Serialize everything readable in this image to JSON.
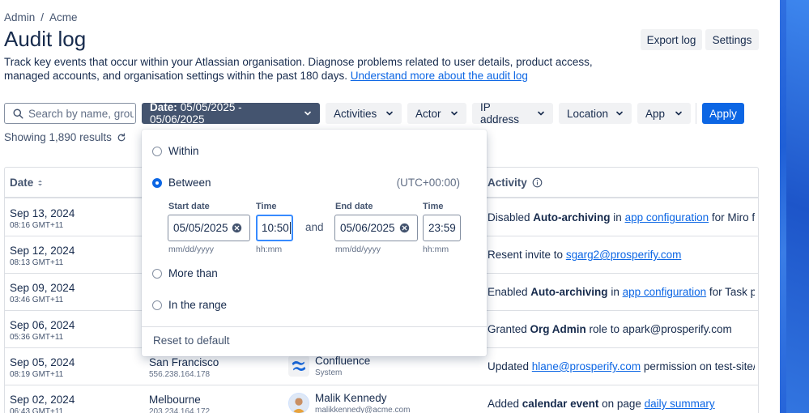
{
  "breadcrumb": {
    "items": [
      "Admin",
      "Acme"
    ],
    "separator": "/"
  },
  "page": {
    "title": "Audit log",
    "description": "Track key events that occur within your Atlassian organisation. Diagnose problems related to user details, product access, managed accounts, and organisation settings within the past 180 days.",
    "learn_link": "Understand more about the audit log"
  },
  "header_actions": {
    "export": "Export log",
    "settings": "Settings"
  },
  "search": {
    "placeholder": "Search by name, group"
  },
  "filters": {
    "date_label": "Date:",
    "date_value": "05/05/2025 - 05/06/2025",
    "activities": "Activities",
    "actor": "Actor",
    "ip": "IP address",
    "location": "Location",
    "app": "App",
    "apply": "Apply"
  },
  "results": {
    "text": "Showing 1,890 results"
  },
  "table": {
    "headers": {
      "date": "Date",
      "activity": "Activity"
    },
    "rows": [
      {
        "date": "Sep 13, 2024",
        "time": "08:16 GMT+11",
        "location": "",
        "ip": "",
        "actor": "",
        "actor_sub": "",
        "activity": [
          {
            "t": "Disabled "
          },
          {
            "b": "Auto-archiving"
          },
          {
            "t": " in "
          },
          {
            "a": "app configuration"
          },
          {
            "t": " for Miro for Con"
          }
        ]
      },
      {
        "date": "Sep 12, 2024",
        "time": "08:13 GMT+11",
        "location": "",
        "ip": "",
        "actor": "",
        "actor_sub": "",
        "activity": [
          {
            "t": "Resent invite to "
          },
          {
            "a": "sgarg2@prosperify.com"
          }
        ]
      },
      {
        "date": "Sep 09, 2024",
        "time": "03:46 GMT+11",
        "location": "",
        "ip": "",
        "actor": "",
        "actor_sub": "",
        "activity": [
          {
            "t": "Enabled "
          },
          {
            "b": "Auto-archiving"
          },
          {
            "t": " in "
          },
          {
            "a": "app configuration"
          },
          {
            "t": " for Task planner"
          }
        ]
      },
      {
        "date": "Sep 06, 2024",
        "time": "05:36 GMT+11",
        "location": "",
        "ip": "",
        "actor": "",
        "actor_sub": "",
        "activity": [
          {
            "t": "Granted "
          },
          {
            "b": "Org Admin"
          },
          {
            "t": " role to apark@prosperify.com"
          }
        ]
      },
      {
        "date": "Sep 05, 2024",
        "time": "08:19 GMT+11",
        "location": "San Francisco",
        "ip": "556.238.164.178",
        "actor": "Confluence",
        "actor_sub": "System",
        "activity": [
          {
            "t": "Updated "
          },
          {
            "a": "hlane@prosperify.com"
          },
          {
            "t": " permission on test-site/produ"
          }
        ]
      },
      {
        "date": "Sep 02, 2024",
        "time": "06:43 GMT+11",
        "location": "Melbourne",
        "ip": "203.234.164.172",
        "actor": "Malik Kennedy",
        "actor_sub": "malikkennedy@acme.com",
        "activity": [
          {
            "t": "Added "
          },
          {
            "b": "calendar event"
          },
          {
            "t": " on page "
          },
          {
            "a": "daily summary"
          }
        ]
      }
    ]
  },
  "date_popup": {
    "options": [
      "Within",
      "Between",
      "More than",
      "In the range"
    ],
    "selected": "Between",
    "timezone": "(UTC+00:00)",
    "start_date_label": "Start date",
    "start_date_value": "05/05/2025",
    "start_time_label": "Time",
    "start_time_value": "10:50",
    "end_date_label": "End date",
    "end_date_value": "05/06/2025",
    "end_time_label": "Time",
    "end_time_value": "23:59",
    "date_hint": "mm/dd/yyyy",
    "time_hint": "hh:mm",
    "and_text": "and",
    "reset": "Reset to default"
  },
  "colors": {
    "primary": "#0c66e4",
    "date_filter_bg": "#44546f",
    "text": "#172b4d",
    "subtle": "#44546f"
  }
}
